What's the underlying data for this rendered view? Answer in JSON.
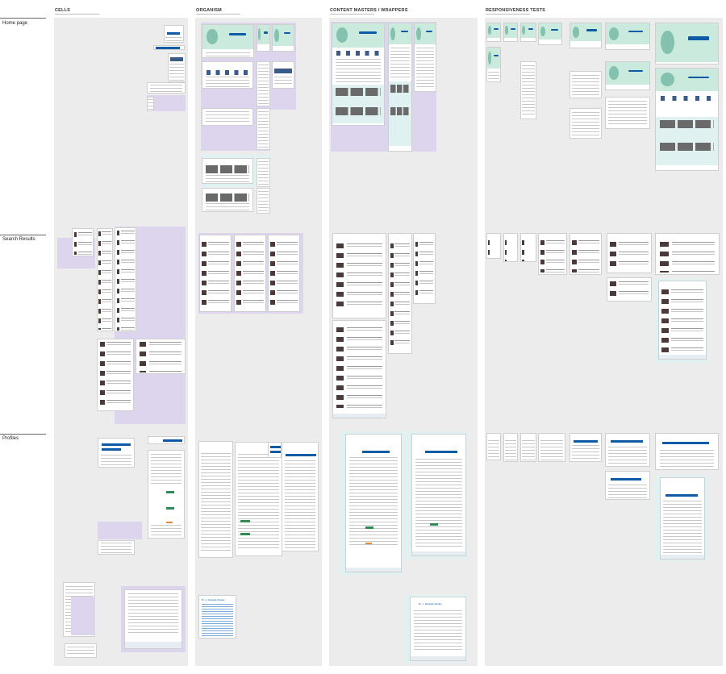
{
  "columns": {
    "cells": "CELLS",
    "organism": "ORGANISM",
    "content_masters": "CONTENT MASTERS / WRAPPERS",
    "responsiveness": "RESPONSIVENESS TESTS"
  },
  "rows": {
    "home_page": "Home page",
    "search_results": "Search Results",
    "profiles": "Profiles"
  },
  "colors": {
    "canvas": "#ffffff",
    "lane": "#ececec",
    "purple_group": "#ddd5ee",
    "teal_group": "#dff1f0",
    "hero_green": "#c9eadc",
    "primary_blue": "#0d5aa7"
  },
  "frames": {
    "profile_name": "Dr. L. Danielle Marley",
    "profile_name_short": "Dr. L. Danielle Marley"
  }
}
